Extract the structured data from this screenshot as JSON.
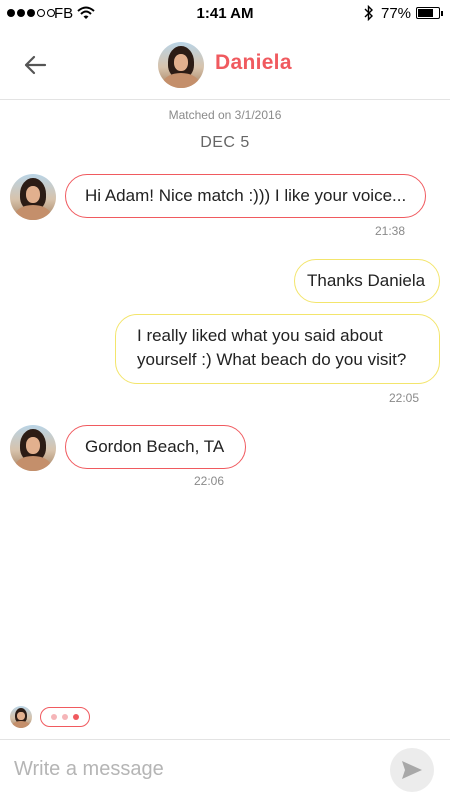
{
  "status_bar": {
    "carrier": "FB",
    "time": "1:41 AM",
    "battery": "77%",
    "battery_level": 0.77
  },
  "header": {
    "back_icon": "arrow-left-icon",
    "contact_name": "Daniela"
  },
  "chat": {
    "matched_text": "Matched on 3/1/2016",
    "date_separator": "DEC 5",
    "messages": [
      {
        "direction": "incoming",
        "text": "Hi Adam! Nice match :))) I like your voice...",
        "time": "21:38"
      },
      {
        "direction": "outgoing",
        "text": "Thanks Daniela",
        "time": ""
      },
      {
        "direction": "outgoing",
        "text": "I really liked what you said about yourself :) What beach do you visit?",
        "time": "22:05"
      },
      {
        "direction": "incoming",
        "text": "Gordon Beach, TA",
        "time": "22:06"
      }
    ]
  },
  "composer": {
    "placeholder": "Write a message",
    "value": "",
    "send_icon": "send-icon"
  },
  "colors": {
    "accent": "#f05a5f",
    "outgoing_border": "#f3e56c",
    "typing_dot_light": "#f5b5b8"
  }
}
